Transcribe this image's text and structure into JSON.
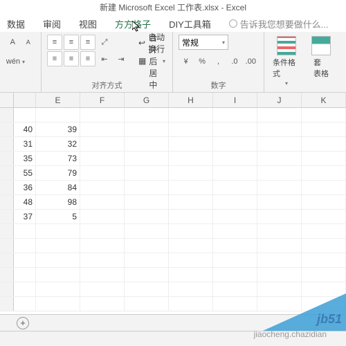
{
  "title": "新建 Microsoft Excel 工作表.xlsx - Excel",
  "tabs": {
    "t0": "数据",
    "t1": "审阅",
    "t2": "视图",
    "t3": "方方格子",
    "t4": "DIY工具箱",
    "tellme": "告诉我您想要做什么..."
  },
  "ribbon": {
    "font": {
      "a1": "A",
      "a2": "A",
      "wen": "wén",
      "grp": ""
    },
    "align": {
      "wrap": "自动换行",
      "merge": "合并后居中",
      "grp": "对齐方式"
    },
    "number": {
      "format": "常规",
      "grp": "数字",
      "pct": "%",
      "comma": ",",
      "inc": ".0",
      "dec": ".00"
    },
    "styles": {
      "cond": "条件格式",
      "table": "套\n表格"
    }
  },
  "columns": [
    "",
    "E",
    "F",
    "G",
    "H",
    "I",
    "J",
    "K"
  ],
  "cells": {
    "D": [
      "40",
      "31",
      "35",
      "55",
      "36",
      "48",
      "37"
    ],
    "E": [
      "39",
      "32",
      "73",
      "79",
      "84",
      "98",
      "5"
    ]
  },
  "sheet": {
    "plus": "+"
  },
  "watermark": {
    "w1": "jb51",
    "w2": "jiaocheng.chazidian"
  }
}
